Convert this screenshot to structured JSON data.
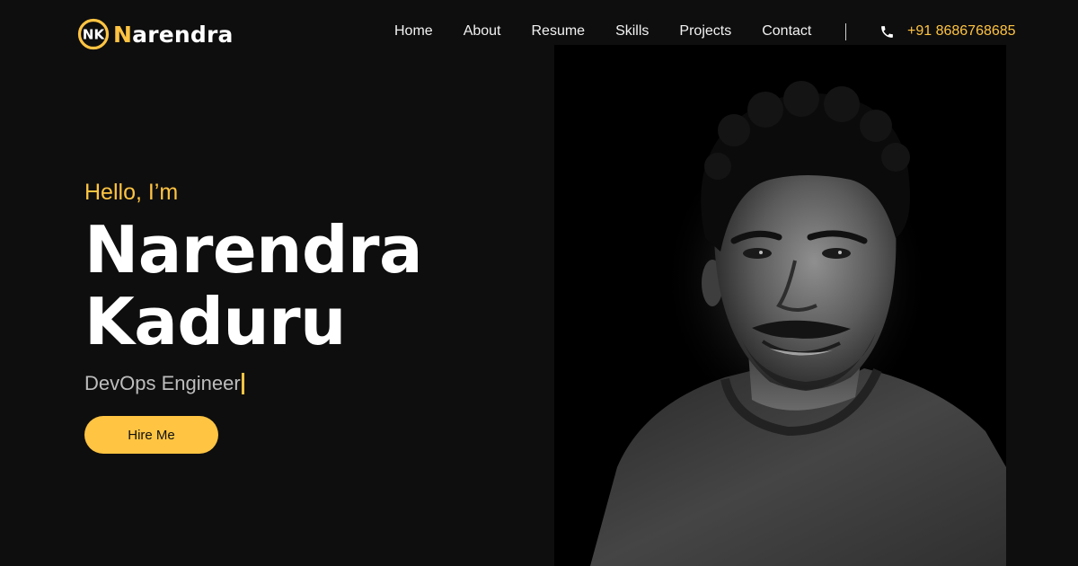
{
  "header": {
    "logo": {
      "mark": "NK",
      "initial": "N",
      "rest": "arendra"
    },
    "nav": [
      {
        "label": "Home"
      },
      {
        "label": "About"
      },
      {
        "label": "Resume"
      },
      {
        "label": "Skills"
      },
      {
        "label": "Projects"
      },
      {
        "label": "Contact"
      }
    ],
    "phone": {
      "icon": "phone-icon",
      "number": "+91 8686768685"
    }
  },
  "hero": {
    "greeting": "Hello, I’m",
    "name_line1": "Narendra",
    "name_line2": "Kaduru",
    "role": "DevOps Engineer",
    "cta_label": "Hire Me",
    "portrait_alt": "Portrait photo"
  },
  "colors": {
    "background": "#0e0e0e",
    "accent": "#ffc442",
    "text": "#ffffff",
    "muted": "#bdbdbd"
  }
}
